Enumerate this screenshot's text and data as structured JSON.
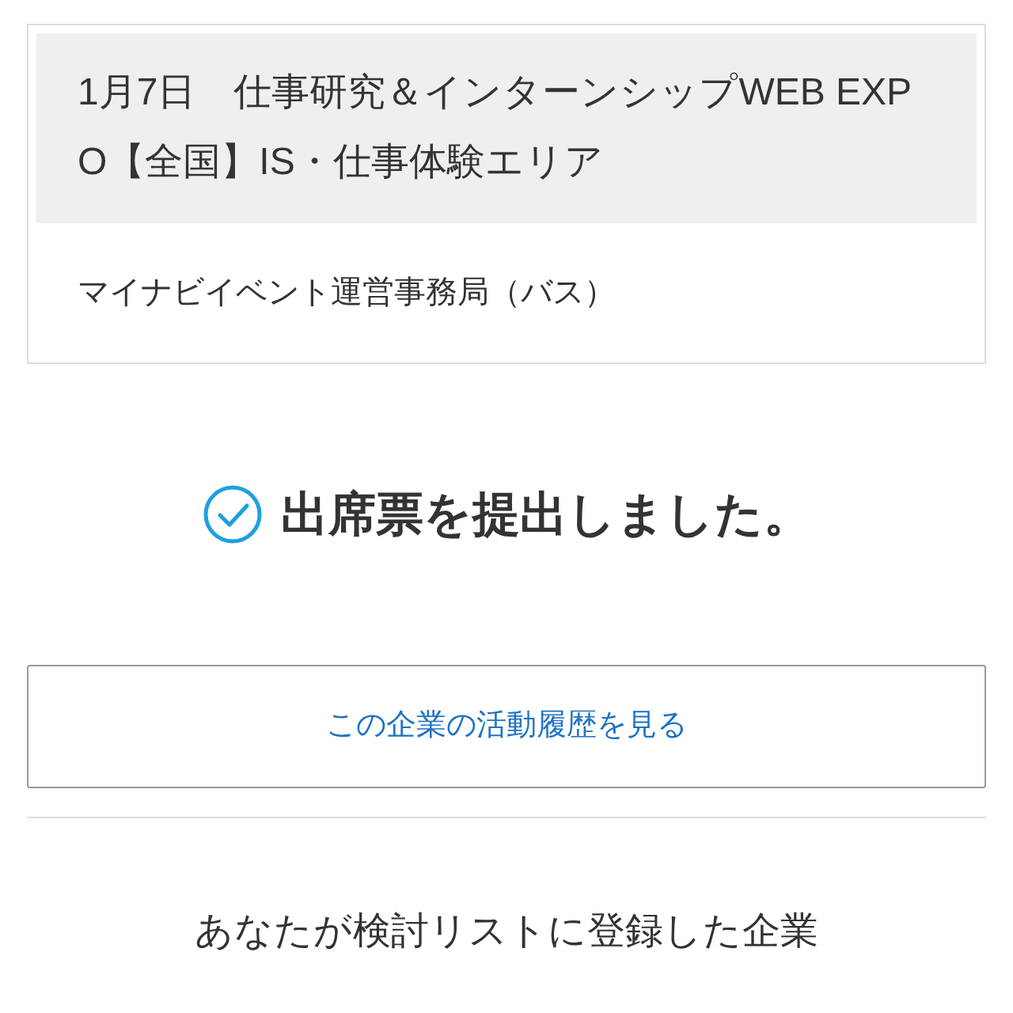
{
  "event": {
    "title": "1月7日　仕事研究＆インターンシップWEB EXPO【全国】IS・仕事体験エリア",
    "organizer": "マイナビイベント運営事務局（バス）"
  },
  "status": {
    "kind": "success",
    "message": "出席票を提出しました。"
  },
  "history_button": {
    "label": "この企業の活動履歴を見る"
  },
  "section_heading": "あなたが検討リストに登録した企業"
}
